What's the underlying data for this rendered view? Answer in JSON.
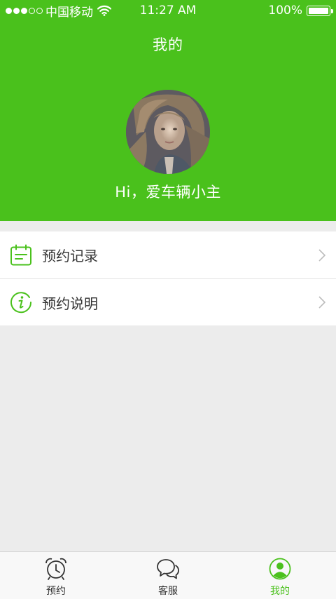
{
  "status_bar": {
    "carrier": "中国移动",
    "time": "11:27 AM",
    "battery": "100%",
    "signal_strength": 3,
    "signal_max": 5
  },
  "header": {
    "title": "我的",
    "greeting": "Hi，爱车辆小主",
    "background_color": "#4ac11c"
  },
  "menu": {
    "items": [
      {
        "label": "预约记录",
        "icon": "calendar-icon"
      },
      {
        "label": "预约说明",
        "icon": "info-icon"
      }
    ]
  },
  "tabbar": {
    "tabs": [
      {
        "label": "预约",
        "icon": "alarm-clock-icon",
        "active": false
      },
      {
        "label": "客服",
        "icon": "chat-bubbles-icon",
        "active": false
      },
      {
        "label": "我的",
        "icon": "user-profile-icon",
        "active": true
      }
    ],
    "active_color": "#4ac11c"
  }
}
